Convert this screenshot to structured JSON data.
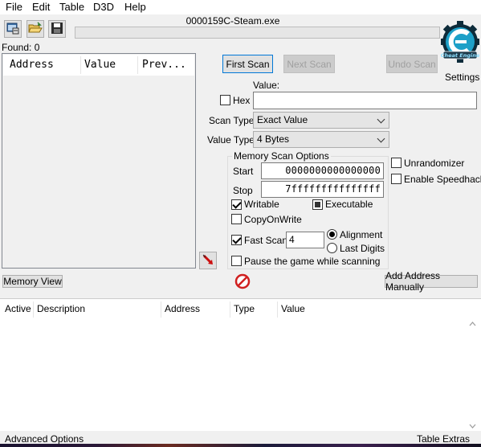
{
  "menu": [
    "File",
    "Edit",
    "Table",
    "D3D",
    "Help"
  ],
  "toolbar": {
    "icons": [
      "select-process-icon",
      "open-file-icon",
      "save-icon"
    ]
  },
  "process_title": "0000159C-Steam.exe",
  "scan_progress": 0,
  "settings_label": "Settings",
  "found_label": "Found: 0",
  "result_columns": [
    "Address",
    "Value",
    "Prev..."
  ],
  "buttons": {
    "first_scan": "First Scan",
    "next_scan": "Next Scan",
    "undo_scan": "Undo Scan",
    "memory_view": "Memory View",
    "add_address": "Add Address Manually"
  },
  "value_label": "Value:",
  "hex_label": "Hex",
  "hex_checked": false,
  "value_input": "",
  "scan_type": {
    "label": "Scan Type",
    "selected": "Exact Value"
  },
  "value_type": {
    "label": "Value Type",
    "selected": "4 Bytes"
  },
  "memory_options": {
    "title": "Memory Scan Options",
    "start_label": "Start",
    "start_value": "0000000000000000",
    "stop_label": "Stop",
    "stop_value": "7fffffffffffffff",
    "writable_label": "Writable",
    "writable": true,
    "executable_label": "Executable",
    "executable": "indeterminate",
    "copyonwrite_label": "CopyOnWrite",
    "copyonwrite": false,
    "fastscan_label": "Fast Scan",
    "fastscan": true,
    "fastscan_value": "4",
    "alignment_label": "Alignment",
    "lastdigits_label": "Last Digits",
    "selected_mode": "Alignment",
    "pause_label": "Pause the game while scanning",
    "pause": false
  },
  "unrandomizer_label": "Unrandomizer",
  "speedhack_label": "Enable Speedhack",
  "table_columns": [
    "Active",
    "Description",
    "Address",
    "Type",
    "Value"
  ],
  "footer": {
    "advanced": "Advanced Options",
    "extras": "Table Extras"
  }
}
